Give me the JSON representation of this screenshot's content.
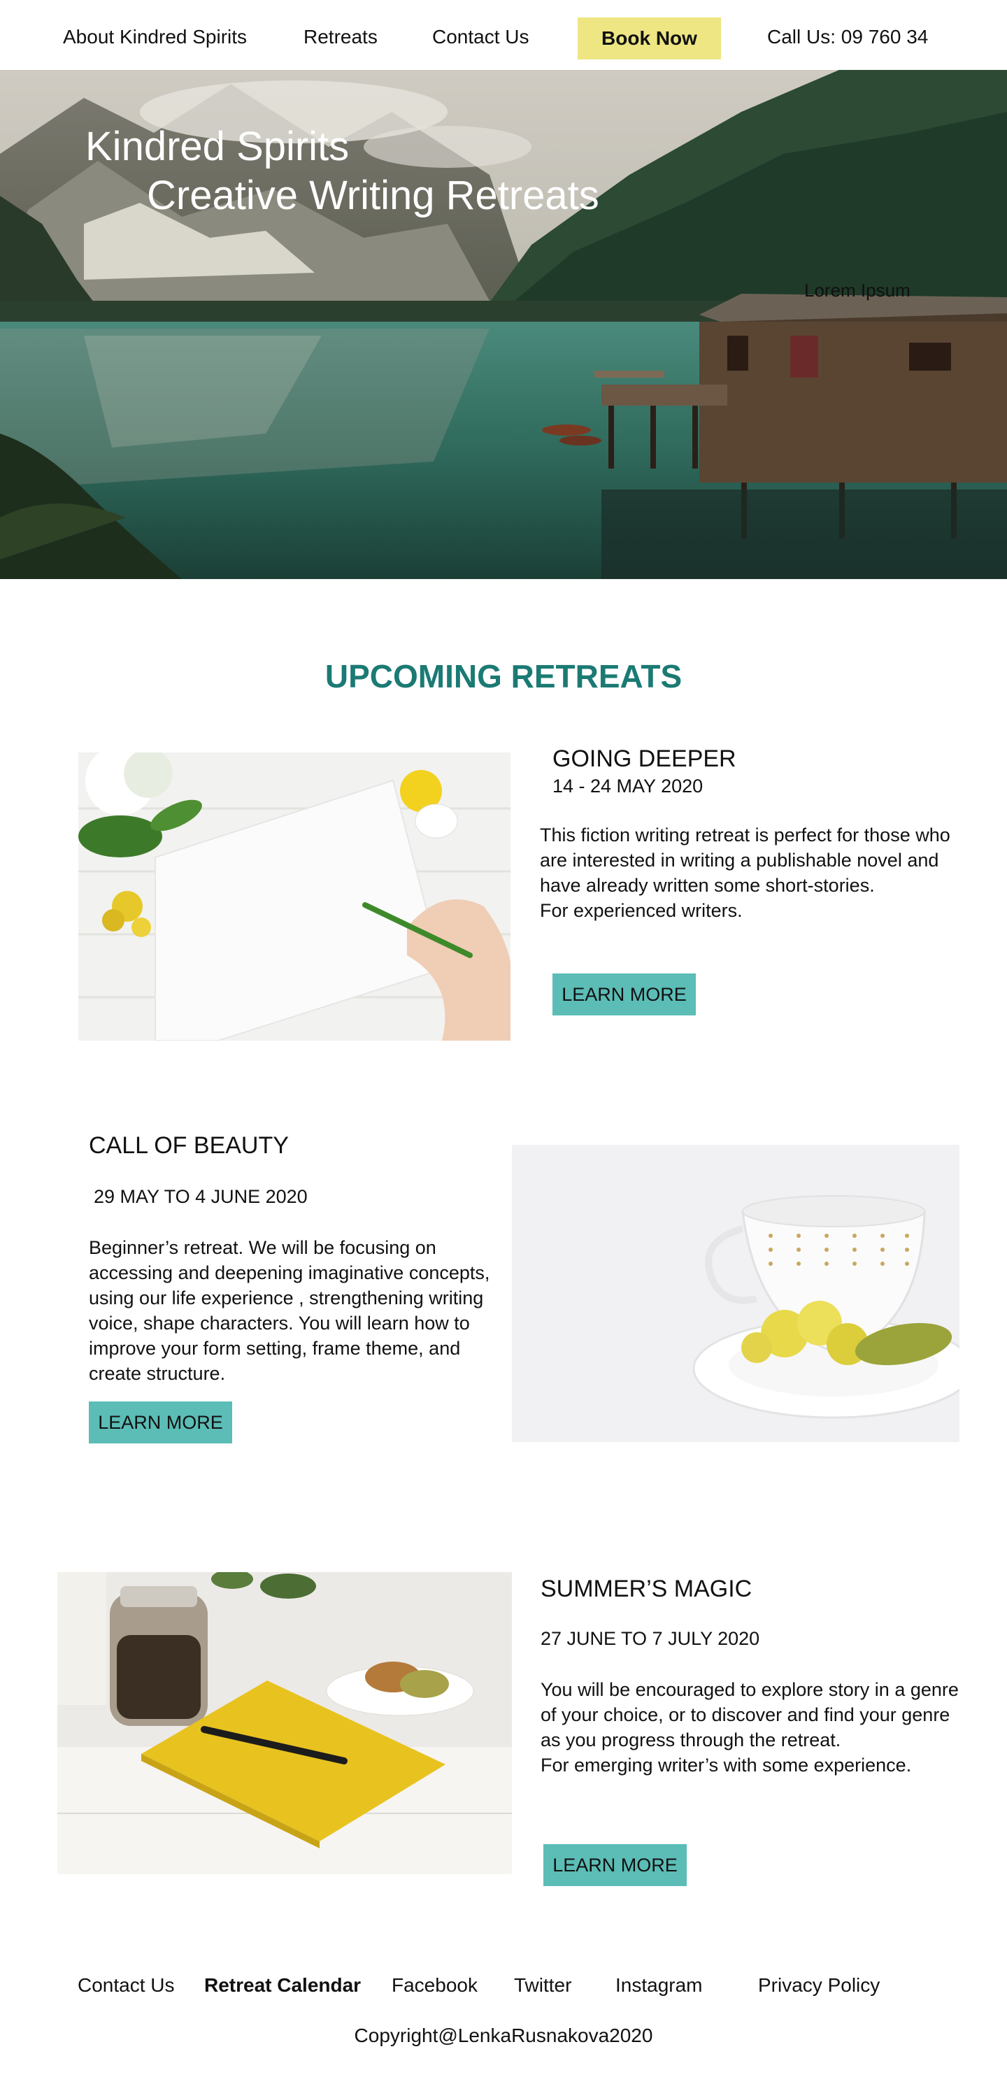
{
  "nav": {
    "about": "About Kindred Spirits",
    "retreats": "Retreats",
    "contact": "Contact Us",
    "book": "Book Now",
    "call": "Call Us: 09 760 34"
  },
  "hero": {
    "title": "Kindred Spirits",
    "subtitle": "Creative Writing Retreats",
    "lorem": "Lorem Ipsum"
  },
  "section_title": "UPCOMING RETREATS",
  "retreats": [
    {
      "title": "GOING DEEPER",
      "date": "14 - 24 MAY 2020",
      "desc_line1": "This fiction writing retreat is perfect for those who are interested in writing a publishable novel and have already written some short-stories.",
      "desc_line2": "For experienced writers.",
      "button": "LEARN MORE"
    },
    {
      "title": "CALL OF BEAUTY",
      "date": "29 MAY TO 4 JUNE 2020",
      "desc_line1": "Beginner’s retreat. We will be focusing on accessing and deepening imaginative concepts, using our life experience , strengthening writing voice, shape characters. You will learn how to improve your form setting, frame theme, and create structure.",
      "button": "LEARN MORE"
    },
    {
      "title": "SUMMER’S MAGIC",
      "date": "27 JUNE TO 7 JULY 2020",
      "desc_line1": "You will be encouraged to explore story in a genre of your choice, or to discover and find your genre as you progress through the retreat.",
      "desc_line2": "For emerging writer’s with some experience.",
      "button": "LEARN MORE"
    }
  ],
  "footer": {
    "contact": "Contact Us",
    "calendar": "Retreat Calendar",
    "facebook": "Facebook",
    "twitter": "Twitter",
    "instagram": "Instagram",
    "privacy": "Privacy Policy",
    "copyright": "Copyright@LenkaRusnakova2020"
  }
}
